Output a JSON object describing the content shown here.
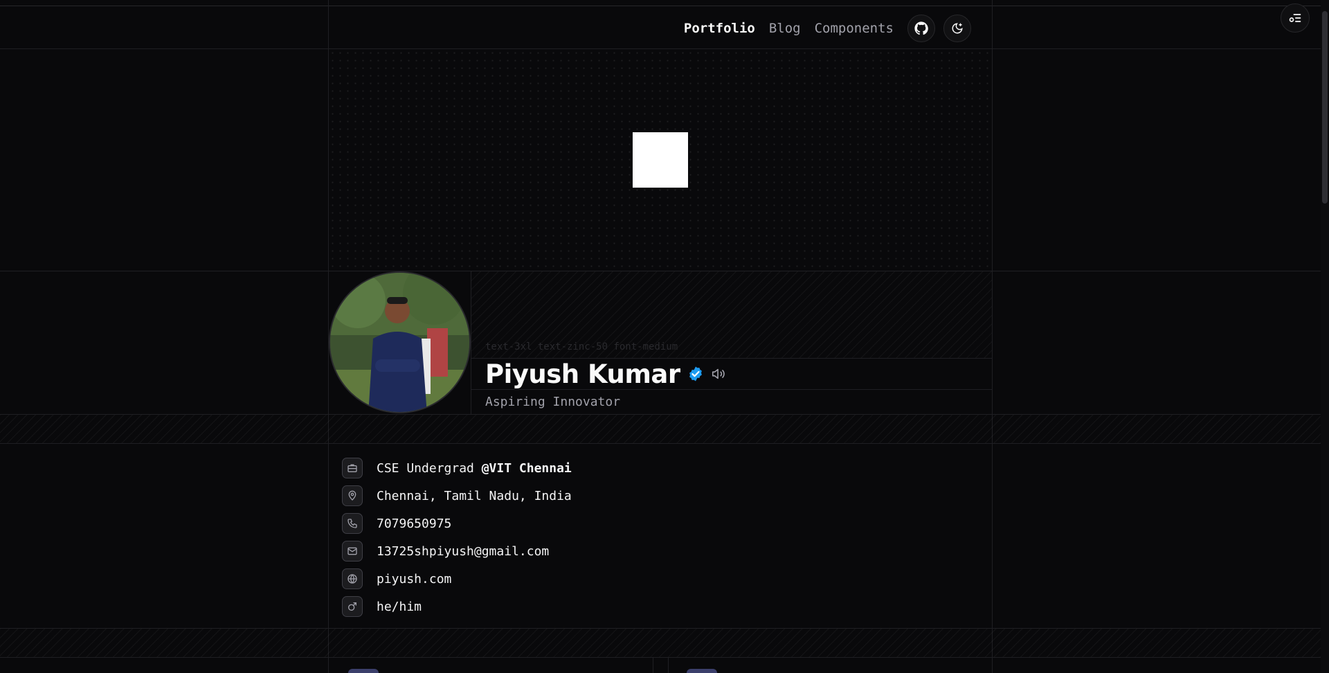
{
  "nav": {
    "links": [
      {
        "label": "Portfolio",
        "active": true
      },
      {
        "label": "Blog",
        "active": false
      },
      {
        "label": "Components",
        "active": false
      }
    ],
    "github_icon": "github-icon",
    "theme_icon": "moon-icon",
    "toc_icon": "list-settings-icon"
  },
  "profile": {
    "placeholder_code": "text-3xl text-zinc-50 font-medium",
    "name": "Piyush Kumar",
    "verified_icon": "verified-badge-icon",
    "verified_color": "#1d9bf0",
    "speaker_icon": "speaker-icon",
    "tagline": "Aspiring Innovator"
  },
  "info": {
    "items": [
      {
        "icon": "briefcase-icon",
        "prefix": "CSE Undergrad ",
        "bold": "@VIT Chennai"
      },
      {
        "icon": "map-pin-icon",
        "text": "Chennai, Tamil Nadu, India"
      },
      {
        "icon": "phone-icon",
        "text": "7079650975"
      },
      {
        "icon": "mail-icon",
        "text": "13725shpiyush@gmail.com"
      },
      {
        "icon": "globe-icon",
        "text": "piyush.com"
      },
      {
        "icon": "mars-icon",
        "text": "he/him"
      }
    ]
  },
  "colors": {
    "background": "#09090b",
    "border": "#1f1f23",
    "muted_text": "#a1a1aa"
  }
}
